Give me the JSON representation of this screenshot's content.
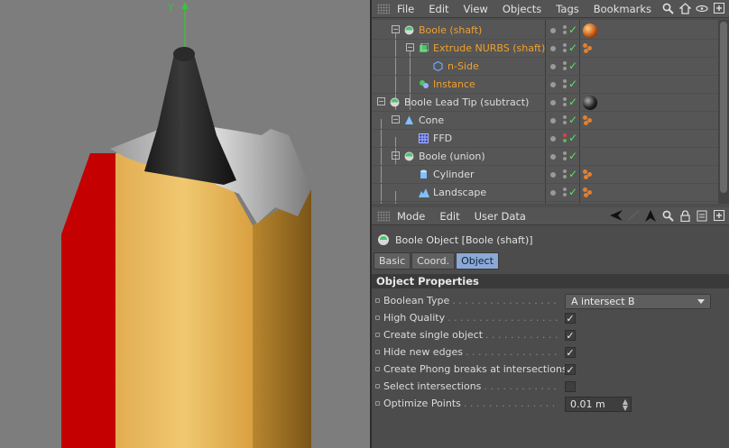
{
  "viewport": {
    "axis_label": "Y"
  },
  "object_manager": {
    "menu": [
      "File",
      "Edit",
      "View",
      "Objects",
      "Tags",
      "Bookmarks"
    ],
    "objects": [
      {
        "name": "Boole (shaft)",
        "color": "orange",
        "icon": "boole-icon",
        "tag": "material-ball-orange"
      },
      {
        "name": "Extrude NURBS (shaft)",
        "color": "orange",
        "icon": "extrude-nurbs-icon",
        "tag": "texture-dots"
      },
      {
        "name": "n-Side",
        "color": "orange",
        "icon": "n-side-spline-icon",
        "tag": ""
      },
      {
        "name": "Instance",
        "color": "orange",
        "icon": "instance-icon",
        "tag": ""
      },
      {
        "name": "Boole Lead Tip (subtract)",
        "color": "white",
        "icon": "boole-icon",
        "tag": "material-ball-black"
      },
      {
        "name": "Cone",
        "color": "white",
        "icon": "cone-icon",
        "tag": "texture-dots"
      },
      {
        "name": "FFD",
        "color": "white",
        "icon": "ffd-icon",
        "tag": ""
      },
      {
        "name": "Boole (union)",
        "color": "white",
        "icon": "boole-icon",
        "tag": ""
      },
      {
        "name": "Cylinder",
        "color": "white",
        "icon": "cylinder-icon",
        "tag": "texture-dots"
      },
      {
        "name": "Landscape",
        "color": "white",
        "icon": "landscape-icon",
        "tag": "texture-dots"
      }
    ]
  },
  "attribute_manager": {
    "menu": [
      "Mode",
      "Edit",
      "User Data"
    ],
    "object_title": "Boole Object [Boole (shaft)]",
    "tabs": [
      "Basic",
      "Coord.",
      "Object"
    ],
    "active_tab": "Object",
    "section_title": "Object Properties",
    "properties": [
      {
        "label": "Boolean Type",
        "type": "dropdown",
        "value": "A intersect B"
      },
      {
        "label": "High Quality",
        "type": "checkbox",
        "checked": true
      },
      {
        "label": "Create single object",
        "type": "checkbox",
        "checked": true
      },
      {
        "label": "Hide new edges",
        "type": "checkbox",
        "checked": true
      },
      {
        "label": "Create Phong breaks at intersections",
        "type": "checkbox",
        "checked": true
      },
      {
        "label": "Select intersections",
        "type": "checkbox",
        "checked": false
      },
      {
        "label": "Optimize Points",
        "type": "number",
        "value": "0.01 m"
      }
    ]
  },
  "colors": {
    "orange_text": "#f0a030",
    "check_green": "#5fe06a",
    "active_tab": "#8aa9d4"
  }
}
